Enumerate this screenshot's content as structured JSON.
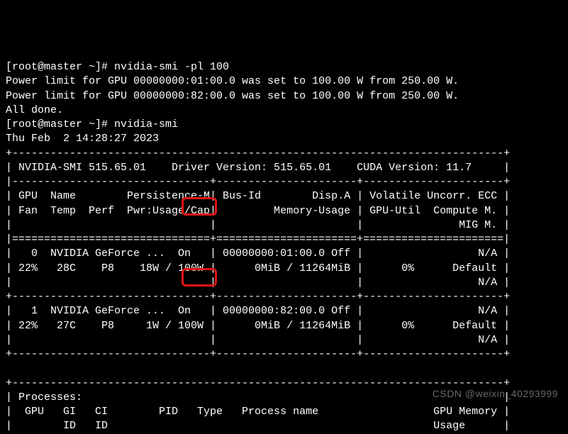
{
  "lines": {
    "prompt1_user": "[root@master ~]# ",
    "cmd1": "nvidia-smi -pl 100",
    "out1": "Power limit for GPU 00000000:01:00.0 was set to 100.00 W from 250.00 W.",
    "out2": "Power limit for GPU 00000000:82:00.0 was set to 100.00 W from 250.00 W.",
    "out3": "All done.",
    "prompt2_user": "[root@master ~]# ",
    "cmd2": "nvidia-smi",
    "timestamp": "Thu Feb  2 14:28:27 2023",
    "t_top": "+-----------------------------------------------------------------------------+",
    "t_ver": "| NVIDIA-SMI 515.65.01    Driver Version: 515.65.01    CUDA Version: 11.7     |",
    "t_hdrsep": "|-------------------------------+----------------------+----------------------+",
    "t_hdr1": "| GPU  Name        Persistence-M| Bus-Id        Disp.A | Volatile Uncorr. ECC |",
    "t_hdr2": "| Fan  Temp  Perf  Pwr:Usage/Cap|         Memory-Usage | GPU-Util  Compute M. |",
    "t_hdr3": "|                               |                      |               MIG M. |",
    "t_eqsep": "|===============================+======================+======================|",
    "g0_l1": "|   0  NVIDIA GeForce ...  On   | 00000000:01:00.0 Off |                  N/A |",
    "g0_l2": "| 22%   28C    P8    18W / 100W |      0MiB / 11264MiB |      0%      Default |",
    "g0_l3": "|                               |                      |                  N/A |",
    "t_rowsep": "+-------------------------------+----------------------+----------------------+",
    "g1_l1": "|   1  NVIDIA GeForce ...  On   | 00000000:82:00.0 Off |                  N/A |",
    "g1_l2": "| 22%   27C    P8     1W / 100W |      0MiB / 11264MiB |      0%      Default |",
    "g1_l3": "|                               |                      |                  N/A |",
    "blank": "                                                                               ",
    "p_top": "+-----------------------------------------------------------------------------+",
    "p_hdr": "| Processes:                                                                  |",
    "p_col1": "|  GPU   GI   CI        PID   Type   Process name                  GPU Memory |",
    "p_col2": "|        ID   ID                                                   Usage      |"
  },
  "chart_data": {
    "type": "table",
    "title": "nvidia-smi",
    "driver_version": "515.65.01",
    "nvidia_smi_version": "515.65.01",
    "cuda_version": "11.7",
    "timestamp": "Thu Feb  2 14:28:27 2023",
    "columns": [
      "GPU",
      "Name",
      "Persistence-M",
      "Bus-Id",
      "Disp.A",
      "Fan",
      "Temp",
      "Perf",
      "Pwr Usage (W)",
      "Pwr Cap (W)",
      "Memory Used (MiB)",
      "Memory Total (MiB)",
      "GPU-Util",
      "Compute M.",
      "Uncorr. ECC",
      "MIG M."
    ],
    "rows": [
      [
        0,
        "NVIDIA GeForce ...",
        "On",
        "00000000:01:00.0",
        "Off",
        "22%",
        "28C",
        "P8",
        18,
        100,
        0,
        11264,
        "0%",
        "Default",
        "N/A",
        "N/A"
      ],
      [
        1,
        "NVIDIA GeForce ...",
        "On",
        "00000000:82:00.0",
        "Off",
        "22%",
        "27C",
        "P8",
        1,
        100,
        0,
        11264,
        "0%",
        "Default",
        "N/A",
        "N/A"
      ]
    ],
    "power_limit_changes": [
      {
        "gpu": "00000000:01:00.0",
        "from_w": 250.0,
        "to_w": 100.0
      },
      {
        "gpu": "00000000:82:00.0",
        "from_w": 250.0,
        "to_w": 100.0
      }
    ]
  },
  "watermark": "CSDN @weixin_40293999",
  "highlights": {
    "gpu0_power_cap": "100W",
    "gpu1_power_cap": "100W"
  }
}
